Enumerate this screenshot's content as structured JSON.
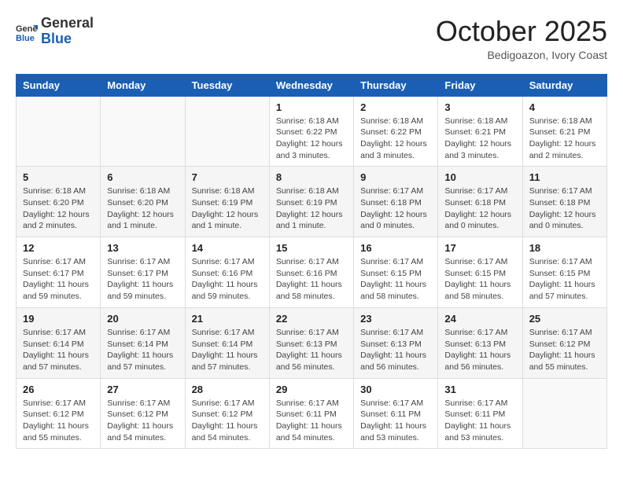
{
  "header": {
    "logo": {
      "general": "General",
      "blue": "Blue"
    },
    "title": "October 2025",
    "location": "Bedigoazon, Ivory Coast"
  },
  "weekdays": [
    "Sunday",
    "Monday",
    "Tuesday",
    "Wednesday",
    "Thursday",
    "Friday",
    "Saturday"
  ],
  "weeks": [
    [
      {
        "day": "",
        "info": ""
      },
      {
        "day": "",
        "info": ""
      },
      {
        "day": "",
        "info": ""
      },
      {
        "day": "1",
        "info": "Sunrise: 6:18 AM\nSunset: 6:22 PM\nDaylight: 12 hours\nand 3 minutes."
      },
      {
        "day": "2",
        "info": "Sunrise: 6:18 AM\nSunset: 6:22 PM\nDaylight: 12 hours\nand 3 minutes."
      },
      {
        "day": "3",
        "info": "Sunrise: 6:18 AM\nSunset: 6:21 PM\nDaylight: 12 hours\nand 3 minutes."
      },
      {
        "day": "4",
        "info": "Sunrise: 6:18 AM\nSunset: 6:21 PM\nDaylight: 12 hours\nand 2 minutes."
      }
    ],
    [
      {
        "day": "5",
        "info": "Sunrise: 6:18 AM\nSunset: 6:20 PM\nDaylight: 12 hours\nand 2 minutes."
      },
      {
        "day": "6",
        "info": "Sunrise: 6:18 AM\nSunset: 6:20 PM\nDaylight: 12 hours\nand 1 minute."
      },
      {
        "day": "7",
        "info": "Sunrise: 6:18 AM\nSunset: 6:19 PM\nDaylight: 12 hours\nand 1 minute."
      },
      {
        "day": "8",
        "info": "Sunrise: 6:18 AM\nSunset: 6:19 PM\nDaylight: 12 hours\nand 1 minute."
      },
      {
        "day": "9",
        "info": "Sunrise: 6:17 AM\nSunset: 6:18 PM\nDaylight: 12 hours\nand 0 minutes."
      },
      {
        "day": "10",
        "info": "Sunrise: 6:17 AM\nSunset: 6:18 PM\nDaylight: 12 hours\nand 0 minutes."
      },
      {
        "day": "11",
        "info": "Sunrise: 6:17 AM\nSunset: 6:18 PM\nDaylight: 12 hours\nand 0 minutes."
      }
    ],
    [
      {
        "day": "12",
        "info": "Sunrise: 6:17 AM\nSunset: 6:17 PM\nDaylight: 11 hours\nand 59 minutes."
      },
      {
        "day": "13",
        "info": "Sunrise: 6:17 AM\nSunset: 6:17 PM\nDaylight: 11 hours\nand 59 minutes."
      },
      {
        "day": "14",
        "info": "Sunrise: 6:17 AM\nSunset: 6:16 PM\nDaylight: 11 hours\nand 59 minutes."
      },
      {
        "day": "15",
        "info": "Sunrise: 6:17 AM\nSunset: 6:16 PM\nDaylight: 11 hours\nand 58 minutes."
      },
      {
        "day": "16",
        "info": "Sunrise: 6:17 AM\nSunset: 6:15 PM\nDaylight: 11 hours\nand 58 minutes."
      },
      {
        "day": "17",
        "info": "Sunrise: 6:17 AM\nSunset: 6:15 PM\nDaylight: 11 hours\nand 58 minutes."
      },
      {
        "day": "18",
        "info": "Sunrise: 6:17 AM\nSunset: 6:15 PM\nDaylight: 11 hours\nand 57 minutes."
      }
    ],
    [
      {
        "day": "19",
        "info": "Sunrise: 6:17 AM\nSunset: 6:14 PM\nDaylight: 11 hours\nand 57 minutes."
      },
      {
        "day": "20",
        "info": "Sunrise: 6:17 AM\nSunset: 6:14 PM\nDaylight: 11 hours\nand 57 minutes."
      },
      {
        "day": "21",
        "info": "Sunrise: 6:17 AM\nSunset: 6:14 PM\nDaylight: 11 hours\nand 57 minutes."
      },
      {
        "day": "22",
        "info": "Sunrise: 6:17 AM\nSunset: 6:13 PM\nDaylight: 11 hours\nand 56 minutes."
      },
      {
        "day": "23",
        "info": "Sunrise: 6:17 AM\nSunset: 6:13 PM\nDaylight: 11 hours\nand 56 minutes."
      },
      {
        "day": "24",
        "info": "Sunrise: 6:17 AM\nSunset: 6:13 PM\nDaylight: 11 hours\nand 56 minutes."
      },
      {
        "day": "25",
        "info": "Sunrise: 6:17 AM\nSunset: 6:12 PM\nDaylight: 11 hours\nand 55 minutes."
      }
    ],
    [
      {
        "day": "26",
        "info": "Sunrise: 6:17 AM\nSunset: 6:12 PM\nDaylight: 11 hours\nand 55 minutes."
      },
      {
        "day": "27",
        "info": "Sunrise: 6:17 AM\nSunset: 6:12 PM\nDaylight: 11 hours\nand 54 minutes."
      },
      {
        "day": "28",
        "info": "Sunrise: 6:17 AM\nSunset: 6:12 PM\nDaylight: 11 hours\nand 54 minutes."
      },
      {
        "day": "29",
        "info": "Sunrise: 6:17 AM\nSunset: 6:11 PM\nDaylight: 11 hours\nand 54 minutes."
      },
      {
        "day": "30",
        "info": "Sunrise: 6:17 AM\nSunset: 6:11 PM\nDaylight: 11 hours\nand 53 minutes."
      },
      {
        "day": "31",
        "info": "Sunrise: 6:17 AM\nSunset: 6:11 PM\nDaylight: 11 hours\nand 53 minutes."
      },
      {
        "day": "",
        "info": ""
      }
    ]
  ]
}
